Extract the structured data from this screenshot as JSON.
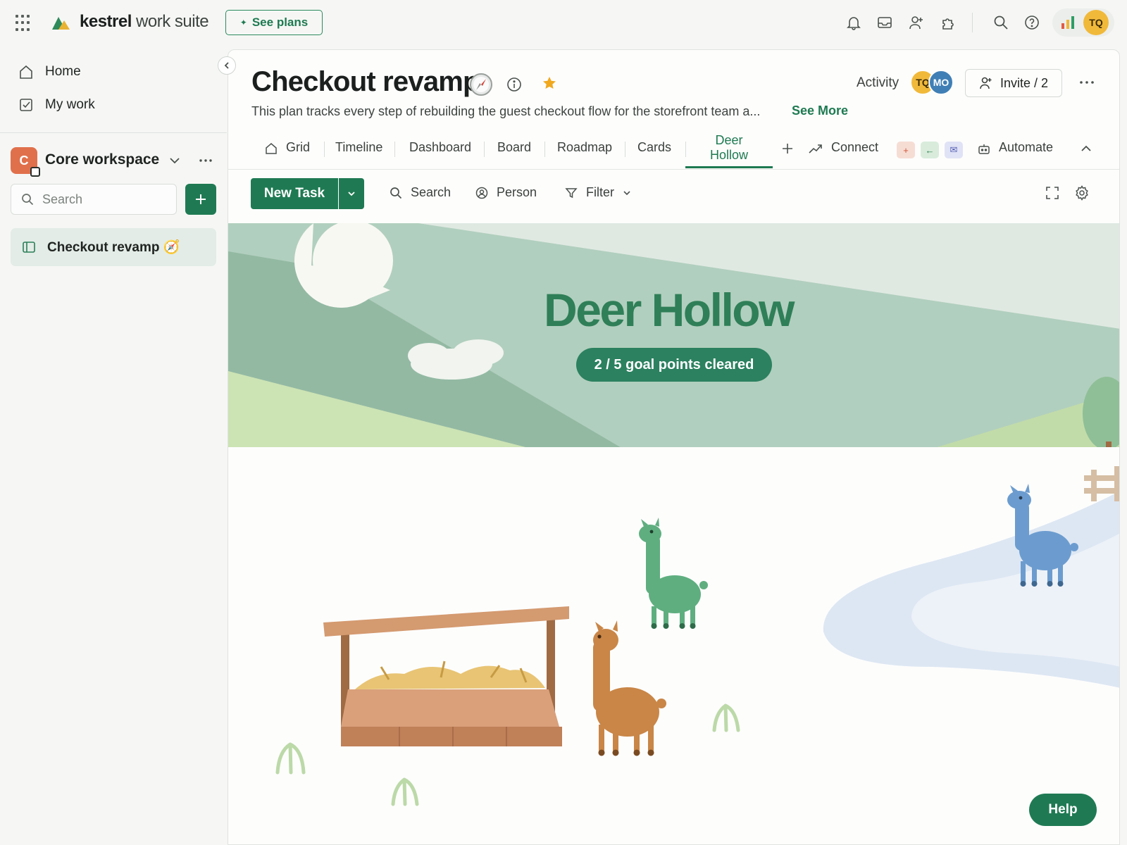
{
  "topbar": {
    "brand_bold": "kestrel",
    "brand_light": " work suite",
    "see_plans_label": "See plans",
    "account_initials": "TQ"
  },
  "sidebar": {
    "nav": [
      {
        "label": "Home",
        "icon": "home-icon"
      },
      {
        "label": "My work",
        "icon": "checkbox-icon"
      }
    ],
    "workspace": {
      "initial": "C",
      "name": "Core workspace"
    },
    "search_placeholder": "Search",
    "boards": [
      {
        "label": "Checkout revamp 🧭",
        "icon": "board-icon"
      }
    ]
  },
  "board": {
    "title": "Checkout revamp",
    "title_emoji": "compass",
    "description": "This plan tracks every step of rebuilding the guest checkout flow for the storefront team a...",
    "see_more_label": "See More",
    "activity_label": "Activity",
    "members": [
      {
        "initials": "TQ",
        "color": "#f1b93a"
      },
      {
        "initials": "MO",
        "color": "#3f7fb5"
      }
    ],
    "invite_label": "Invite / 2",
    "starred": true
  },
  "tabs": {
    "items": [
      "Grid",
      "Timeline",
      "Dashboard",
      "Board",
      "Roadmap",
      "Cards"
    ],
    "active_line1": "Deer",
    "active_line2": "Hollow",
    "connect_label": "Connect",
    "automate_label": "Automate"
  },
  "toolbar": {
    "new_task_label": "New Task",
    "search_label": "Search",
    "person_label": "Person",
    "filter_label": "Filter"
  },
  "scene": {
    "title": "Deer Hollow",
    "goal_text": "2 / 5 goal points cleared",
    "goal_progress": 0.4
  },
  "help_label": "Help",
  "colors": {
    "accent": "#1f7a53",
    "title_green": "#2f7f58",
    "sky": "#dfe9e2",
    "mountain": "#a7c8b6"
  }
}
